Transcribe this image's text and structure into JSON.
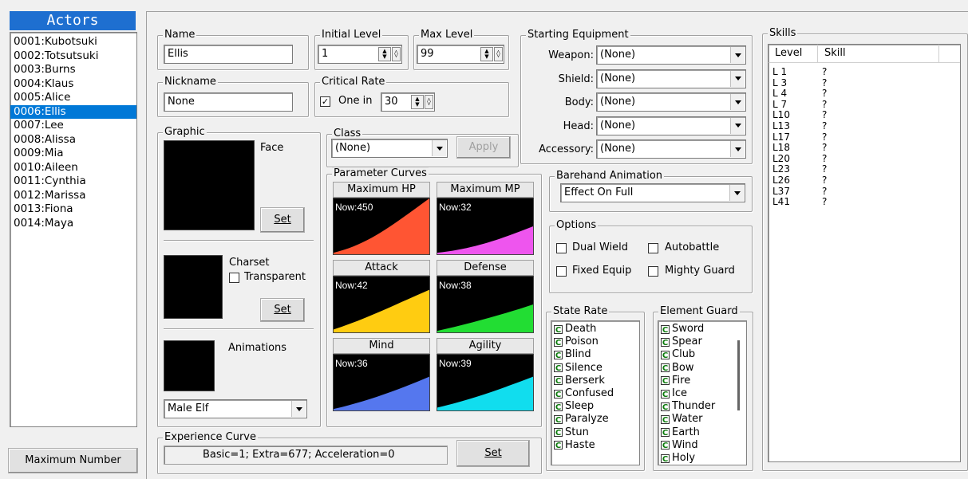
{
  "actors_header": "Actors",
  "actors": [
    "0001:Kubotsuki",
    "0002:Totsutsuki",
    "0003:Burns",
    "0004:Klaus",
    "0005:Alice",
    "0006:Ellis",
    "0007:Lee",
    "0008:Alissa",
    "0009:Mia",
    "0010:Aileen",
    "0011:Cynthia",
    "0012:Marissa",
    "0013:Fiona",
    "0014:Maya"
  ],
  "selected_actor_index": 5,
  "max_number_button": "Maximum Number",
  "name": {
    "label": "Name",
    "value": "Ellis"
  },
  "nickname": {
    "label": "Nickname",
    "value": "None"
  },
  "initial_level": {
    "label": "Initial Level",
    "value": "1"
  },
  "max_level": {
    "label": "Max Level",
    "value": "99"
  },
  "critical_rate": {
    "label": "Critical Rate",
    "checkbox_label": "One in",
    "checked": true,
    "value": "30"
  },
  "graphic": {
    "label": "Graphic",
    "face_label": "Face",
    "set_label": "Set",
    "charset_label": "Charset",
    "transparent_label": "Transparent",
    "animations_label": "Animations",
    "animation_value": "Male Elf"
  },
  "class": {
    "label": "Class",
    "value": "(None)",
    "apply_label": "Apply"
  },
  "parameter_curves": {
    "label": "Parameter Curves",
    "items": [
      {
        "name": "Maximum HP",
        "now": "Now:450",
        "color": "#ff5533"
      },
      {
        "name": "Maximum MP",
        "now": "Now:32",
        "color": "#ee55ee"
      },
      {
        "name": "Attack",
        "now": "Now:42",
        "color": "#ffcc11"
      },
      {
        "name": "Defense",
        "now": "Now:38",
        "color": "#22dd33"
      },
      {
        "name": "Mind",
        "now": "Now:36",
        "color": "#5577ee"
      },
      {
        "name": "Agility",
        "now": "Now:39",
        "color": "#11ddee"
      }
    ]
  },
  "experience": {
    "label": "Experience Curve",
    "value": "Basic=1; Extra=677; Acceleration=0",
    "set_label": "Set"
  },
  "equipment": {
    "label": "Starting Equipment",
    "slots": [
      {
        "name": "Weapon:",
        "value": "(None)"
      },
      {
        "name": "Shield:",
        "value": "(None)"
      },
      {
        "name": "Body:",
        "value": "(None)"
      },
      {
        "name": "Head:",
        "value": "(None)"
      },
      {
        "name": "Accessory:",
        "value": "(None)"
      }
    ]
  },
  "barehand": {
    "label": "Barehand Animation",
    "value": "Effect On Full"
  },
  "options": {
    "label": "Options",
    "dual_wield": "Dual Wield",
    "autobattle": "Autobattle",
    "fixed_equip": "Fixed Equip",
    "mighty_guard": "Mighty Guard"
  },
  "state_rate": {
    "label": "State Rate",
    "items": [
      "Death",
      "Poison",
      "Blind",
      "Silence",
      "Berserk",
      "Confused",
      "Sleep",
      "Paralyze",
      "Stun",
      "Haste"
    ]
  },
  "element_guard": {
    "label": "Element Guard",
    "items": [
      "Sword",
      "Spear",
      "Club",
      "Bow",
      "Fire",
      "Ice",
      "Thunder",
      "Water",
      "Earth",
      "Wind",
      "Holy"
    ]
  },
  "badge_letter": "C",
  "skills": {
    "label": "Skills",
    "col_level": "Level",
    "col_skill": "Skill",
    "rows": [
      {
        "level": "L 1",
        "skill": "?"
      },
      {
        "level": "L 3",
        "skill": "?"
      },
      {
        "level": "L 4",
        "skill": "?"
      },
      {
        "level": "L 7",
        "skill": "?"
      },
      {
        "level": "L10",
        "skill": "?"
      },
      {
        "level": "L13",
        "skill": "?"
      },
      {
        "level": "L17",
        "skill": "?"
      },
      {
        "level": "L18",
        "skill": "?"
      },
      {
        "level": "L20",
        "skill": "?"
      },
      {
        "level": "L23",
        "skill": "?"
      },
      {
        "level": "L26",
        "skill": "?"
      },
      {
        "level": "L37",
        "skill": "?"
      },
      {
        "level": "L41",
        "skill": "?"
      }
    ]
  }
}
